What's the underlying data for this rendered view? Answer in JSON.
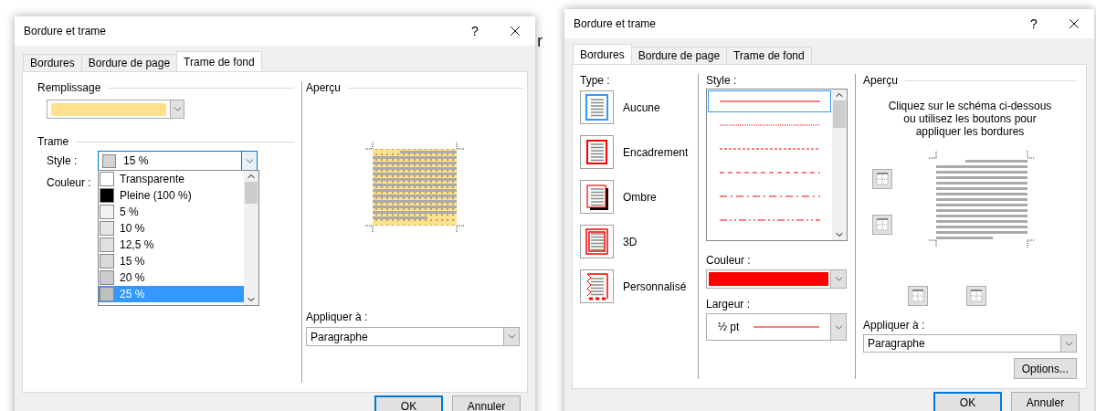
{
  "background_text": "r",
  "dialogs": [
    {
      "kind": "shading",
      "title": "Bordure et trame",
      "help": "?",
      "tabs": [
        {
          "label": "Bordures",
          "selected": false
        },
        {
          "label": "Bordure de page",
          "selected": false
        },
        {
          "label": "Trame de fond",
          "selected": true
        }
      ],
      "fill": {
        "label": "Remplissage",
        "color": "#ffe08c"
      },
      "pattern": {
        "label": "Trame",
        "style_label": "Style :",
        "style": {
          "value": "15 %",
          "color": "#d4d4d4"
        },
        "color_label": "Couleur :",
        "options": [
          {
            "label": "Transparente",
            "color": "#ffffff",
            "selected": false
          },
          {
            "label": "Pleine (100 %)",
            "color": "#000000",
            "selected": false
          },
          {
            "label": "5 %",
            "color": "#f2f2f2",
            "selected": false
          },
          {
            "label": "10 %",
            "color": "#e6e6e6",
            "selected": false
          },
          {
            "label": "12,5 %",
            "color": "#e0e0e0",
            "selected": false
          },
          {
            "label": "15 %",
            "color": "#d9d9d9",
            "selected": false
          },
          {
            "label": "20 %",
            "color": "#cccccc",
            "selected": false
          },
          {
            "label": "25 %",
            "color": "#bfbfbf",
            "selected": true
          }
        ]
      },
      "preview_label": "Aperçu",
      "apply_label": "Appliquer à :",
      "apply_value": "Paragraphe",
      "buttons": [
        {
          "label": "OK",
          "default": true
        },
        {
          "label": "Annuler",
          "default": false
        }
      ]
    },
    {
      "kind": "borders",
      "title": "Bordure et trame",
      "help": "?",
      "tabs": [
        {
          "label": "Bordures",
          "selected": true
        },
        {
          "label": "Bordure de page",
          "selected": false
        },
        {
          "label": "Trame de fond",
          "selected": false
        }
      ],
      "type_label": "Type :",
      "types": [
        {
          "kind": "none",
          "label": "Aucune",
          "selected": true
        },
        {
          "kind": "box",
          "label": "Encadrement",
          "selected": false
        },
        {
          "kind": "shadow",
          "label": "Ombre",
          "selected": false
        },
        {
          "kind": "double",
          "label": "3D",
          "selected": false
        },
        {
          "kind": "custom",
          "label": "Personnalisé",
          "selected": false
        }
      ],
      "style_label": "Style :",
      "styles": [
        {
          "kind": "solid",
          "selected": true
        },
        {
          "kind": "dotted",
          "selected": false
        },
        {
          "kind": "fine-dash",
          "selected": false
        },
        {
          "kind": "dash",
          "selected": false
        },
        {
          "kind": "dash-dot",
          "selected": false
        },
        {
          "kind": "dash-dot-dot",
          "selected": false
        }
      ],
      "color_label": "Couleur :",
      "line": {
        "color": "#ff0000"
      },
      "width_label": "Largeur :",
      "width_value": "½ pt",
      "preview_label": "Aperçu",
      "preview_hint": "Cliquez sur le schéma ci-dessous ou utilisez les boutons pour appliquer les bordures",
      "apply_label": "Appliquer à :",
      "apply_value": "Paragraphe",
      "options_button": "Options...",
      "buttons": [
        {
          "label": "OK",
          "default": true
        },
        {
          "label": "Annuler",
          "default": false
        }
      ]
    }
  ]
}
